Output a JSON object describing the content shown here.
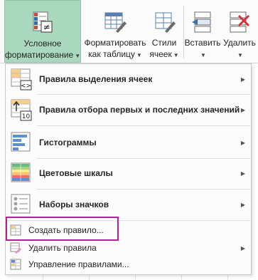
{
  "ribbon": {
    "conditional_formatting": {
      "line1": "Условное",
      "line2": "форматирование"
    },
    "format_as_table": {
      "line1": "Форматировать",
      "line2": "как таблицу"
    },
    "cell_styles": {
      "line1": "Стили",
      "line2": "ячеек"
    },
    "insert": {
      "line1": "Вставить"
    },
    "delete": {
      "line1": "Удалить"
    }
  },
  "menu": {
    "items": [
      {
        "label": "Правила выделения ячеек",
        "has_submenu": true,
        "icon": "highlight-cells-icon"
      },
      {
        "label": "Правила отбора первых и последних значений",
        "has_submenu": true,
        "icon": "top-bottom-icon"
      },
      {
        "label": "Гистограммы",
        "has_submenu": true,
        "icon": "data-bars-icon"
      },
      {
        "label": "Цветовые шкалы",
        "has_submenu": true,
        "icon": "color-scales-icon"
      },
      {
        "label": "Наборы значков",
        "has_submenu": true,
        "icon": "icon-sets-icon"
      }
    ],
    "actions": [
      {
        "label": "Создать правило...",
        "icon": "new-rule-icon",
        "has_submenu": false
      },
      {
        "label": "Удалить правила",
        "icon": "clear-rules-icon",
        "has_submenu": true
      },
      {
        "label": "Управление правилами...",
        "icon": "manage-rules-icon",
        "has_submenu": false
      }
    ],
    "top_bottom_icon_text": "10",
    "highlight_icon_text": "<>"
  },
  "colors": {
    "active_button": "#a9d8be",
    "highlight_frame": "#b5209a",
    "accent_green": "#217346"
  }
}
